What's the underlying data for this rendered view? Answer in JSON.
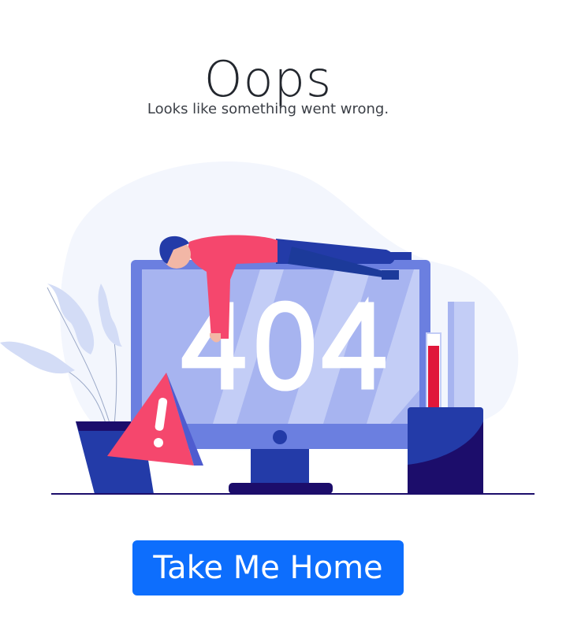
{
  "header": {
    "title": "Oops",
    "subtitle": "Looks like something went wrong."
  },
  "illustration": {
    "screen_text": "404",
    "icons": [
      "monitor-icon",
      "warning-triangle-icon",
      "plant-icon",
      "pen-cup-icon",
      "sleeping-person-icon"
    ]
  },
  "actions": {
    "home_button_label": "Take Me Home"
  },
  "colors": {
    "primary_button": "#0d6efd",
    "monitor_frame": "#6b7fe0",
    "screen": "#a7b4f0",
    "warning": "#f5476d",
    "dark_navy": "#1c0d6b"
  }
}
